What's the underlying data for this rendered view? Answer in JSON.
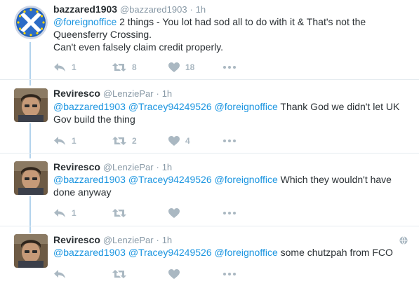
{
  "tweets": [
    {
      "name": "bazzared1903",
      "handle": "@bazzared1903",
      "dot": "·",
      "time": "1h",
      "line1": [
        {
          "t": "@foreignoffice",
          "m": true
        },
        {
          "t": " 2 things - You lot had sod all to do with it & That's not the",
          "m": false
        }
      ],
      "line2": "Queensferry Crossing.",
      "line3": "Can't even falsely claim credit properly.",
      "replies": "1",
      "retweets": "8",
      "likes": "18"
    },
    {
      "name": "Reviresco",
      "handle": "@LenziePar",
      "dot": "·",
      "time": "1h",
      "line1": [
        {
          "t": "@bazzared1903",
          "m": true
        },
        {
          "t": " ",
          "m": false
        },
        {
          "t": "@Tracey94249526",
          "m": true
        },
        {
          "t": " ",
          "m": false
        },
        {
          "t": "@foreignoffice",
          "m": true
        },
        {
          "t": " Thank God we didn't let UK",
          "m": false
        }
      ],
      "line2": "Gov build the thing",
      "replies": "1",
      "retweets": "2",
      "likes": "4"
    },
    {
      "name": "Reviresco",
      "handle": "@LenziePar",
      "dot": "·",
      "time": "1h",
      "line1": [
        {
          "t": "@bazzared1903",
          "m": true
        },
        {
          "t": " ",
          "m": false
        },
        {
          "t": "@Tracey94249526",
          "m": true
        },
        {
          "t": " ",
          "m": false
        },
        {
          "t": "@foreignoffice",
          "m": true
        },
        {
          "t": " Which they wouldn't have",
          "m": false
        }
      ],
      "line2": "done anyway",
      "replies": "1",
      "retweets": "",
      "likes": ""
    },
    {
      "name": "Reviresco",
      "handle": "@LenziePar",
      "dot": "·",
      "time": "1h",
      "line1": [
        {
          "t": "@bazzared1903",
          "m": true
        },
        {
          "t": " ",
          "m": false
        },
        {
          "t": "@Tracey94249526",
          "m": true
        },
        {
          "t": " ",
          "m": false
        },
        {
          "t": "@foreignoffice",
          "m": true
        },
        {
          "t": " some chutzpah from FCO",
          "m": false
        }
      ],
      "replies": "",
      "retweets": "",
      "likes": ""
    }
  ],
  "icons": {
    "reply": "reply-icon",
    "retweet": "retweet-icon",
    "like": "heart-icon",
    "more": "more-icon",
    "globe": "globe-icon"
  },
  "colors": {
    "mention": "#1b95e0",
    "thread_line": "#b3d3ec",
    "action_gray": "#aab8c2",
    "meta_gray": "#8899a6",
    "text": "#292f33"
  }
}
